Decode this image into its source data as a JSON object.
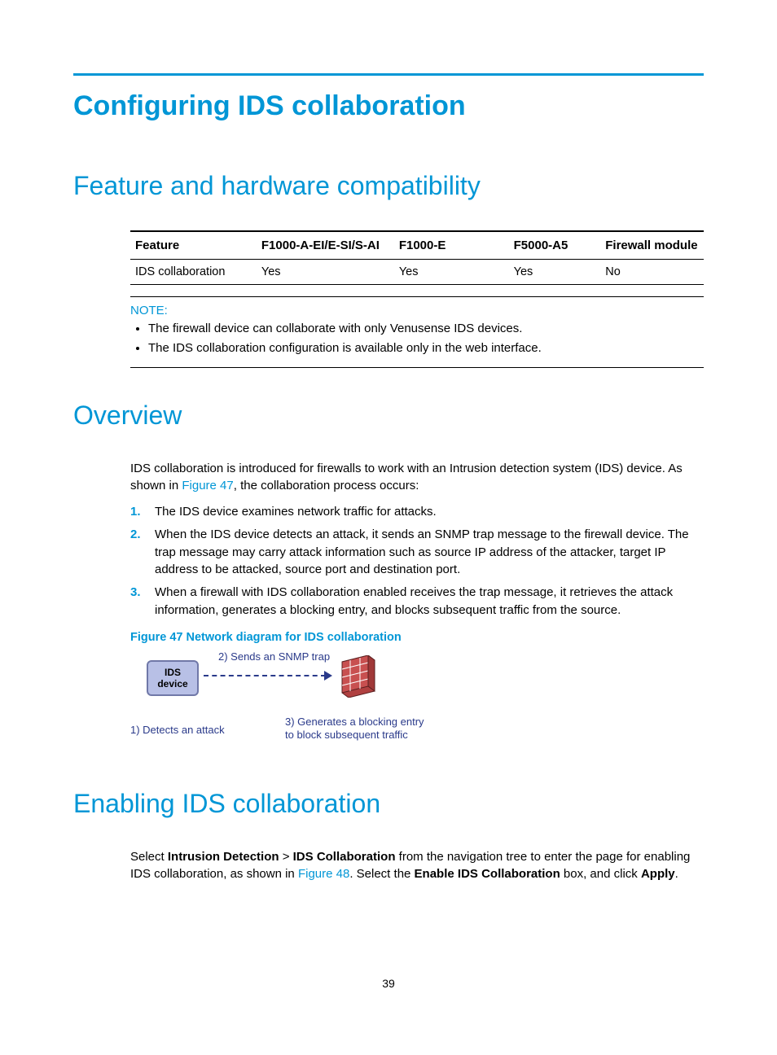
{
  "title": "Configuring IDS collaboration",
  "section_compat": "Feature and hardware compatibility",
  "compat_table": {
    "headers": [
      "Feature",
      "F1000-A-EI/E-SI/S-AI",
      "F1000-E",
      "F5000-A5",
      "Firewall module"
    ],
    "row": [
      "IDS collaboration",
      "Yes",
      "Yes",
      "Yes",
      "No"
    ]
  },
  "note_label": "NOTE:",
  "note_items": [
    "The firewall device can collaborate with only Venusense IDS devices.",
    "The IDS collaboration configuration is available only in the web interface."
  ],
  "section_overview": "Overview",
  "overview_para_a": "IDS collaboration is introduced for firewalls to work with an Intrusion detection system (IDS) device. As shown in ",
  "overview_fig_link": "Figure 47",
  "overview_para_b": ", the collaboration process occurs:",
  "steps": [
    "The IDS device examines network traffic for attacks.",
    "When the IDS device detects an attack, it sends an SNMP trap message to the firewall device. The trap message may carry attack information such as source IP address of the attacker, target IP address to be attacked, source port and destination port.",
    "When a firewall with IDS collaboration enabled receives the trap message, it retrieves the attack information, generates a blocking entry, and blocks subsequent traffic from the source."
  ],
  "figure_caption": "Figure 47 Network diagram for IDS collaboration",
  "diagram": {
    "ids_line1": "IDS",
    "ids_line2": "device",
    "snmp": "2) Sends an SNMP trap",
    "detect": "1) Detects an attack",
    "block_l1": "3) Generates a blocking entry",
    "block_l2": "to block subsequent traffic"
  },
  "section_enable": "Enabling IDS collaboration",
  "enable_a": "Select ",
  "enable_b": "Intrusion Detection",
  "enable_c": " > ",
  "enable_d": "IDS Collaboration",
  "enable_e": " from the navigation tree to enter the page for enabling IDS collaboration, as shown in ",
  "enable_fig_link": "Figure 48",
  "enable_f": ". Select the ",
  "enable_g": "Enable IDS Collaboration",
  "enable_h": " box, and click ",
  "enable_i": "Apply",
  "enable_j": ".",
  "page_number": "39"
}
